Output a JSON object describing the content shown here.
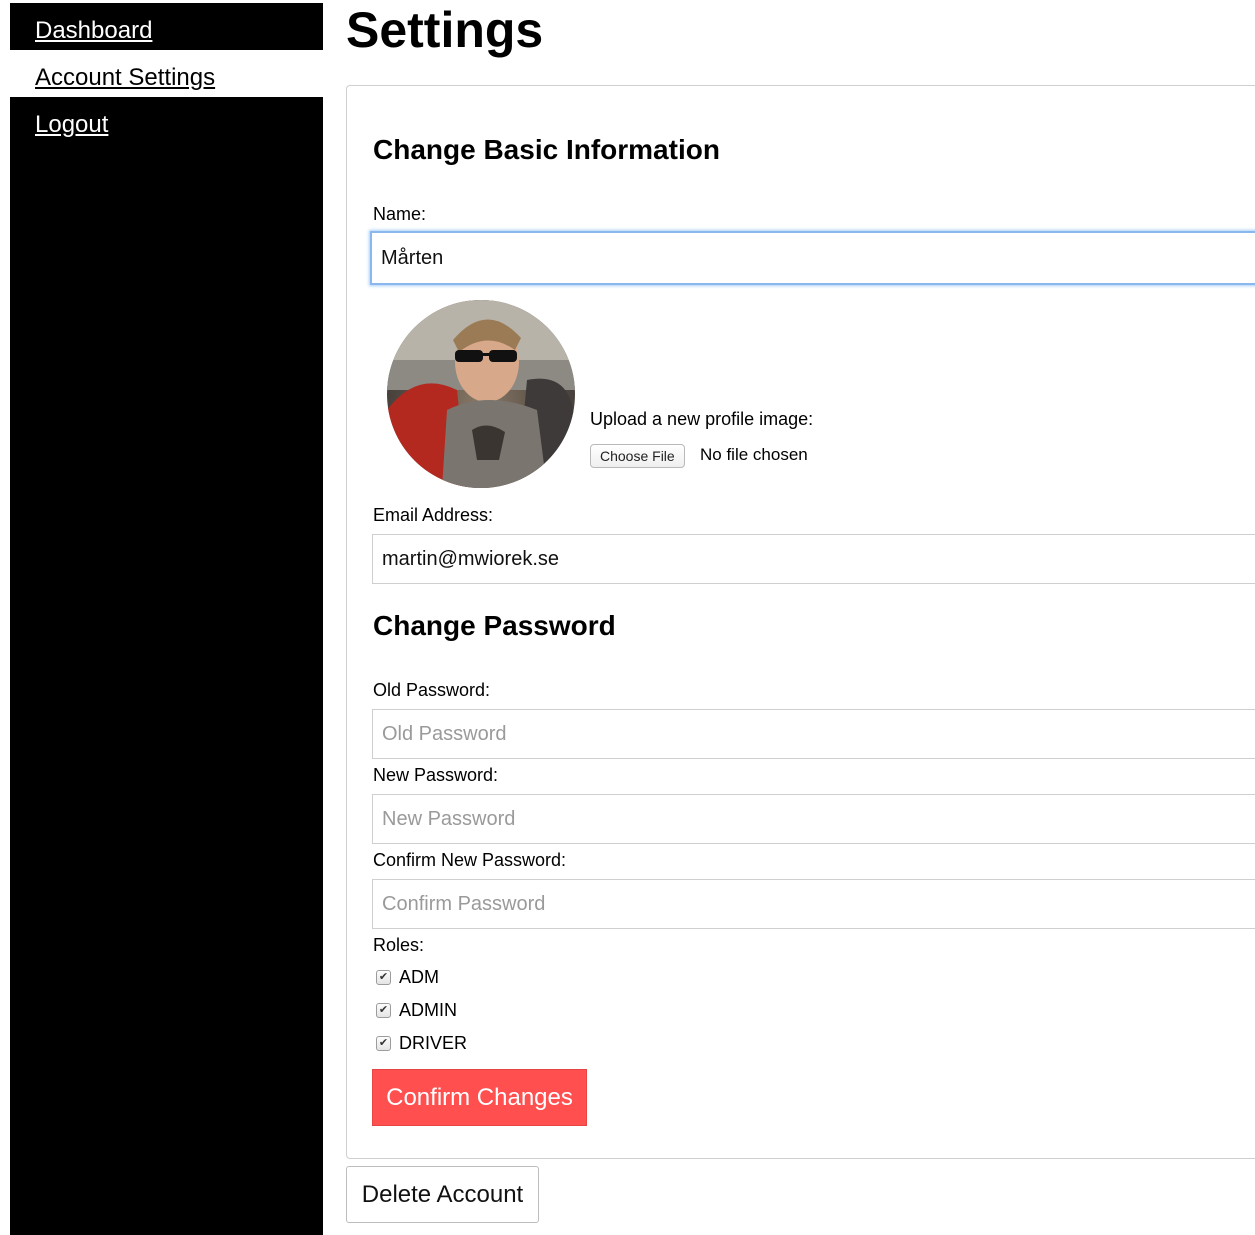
{
  "sidebar": {
    "items": [
      {
        "label": "Dashboard",
        "active": false
      },
      {
        "label": "Account Settings",
        "active": true
      },
      {
        "label": "Logout",
        "active": false
      }
    ]
  },
  "page": {
    "title": "Settings"
  },
  "basic_info": {
    "heading": "Change Basic Information",
    "name_label": "Name:",
    "name_value": "Mårten",
    "upload_label": "Upload a new profile image:",
    "choose_file_label": "Choose File",
    "no_file_text": "No file chosen",
    "email_label": "Email Address:",
    "email_value": "martin@mwiorek.se"
  },
  "password": {
    "heading": "Change Password",
    "old_label": "Old Password:",
    "old_placeholder": "Old Password",
    "new_label": "New Password:",
    "new_placeholder": "New Password",
    "confirm_label": "Confirm New Password:",
    "confirm_placeholder": "Confirm Password"
  },
  "roles": {
    "label": "Roles:",
    "items": [
      {
        "label": "ADM",
        "checked": true
      },
      {
        "label": "ADMIN",
        "checked": true
      },
      {
        "label": "DRIVER",
        "checked": true
      }
    ]
  },
  "actions": {
    "confirm_label": "Confirm Changes",
    "delete_label": "Delete Account"
  },
  "colors": {
    "confirm_button": "#ff4f4f",
    "sidebar": "#000000",
    "focus_ring": "#8ab8ee"
  }
}
